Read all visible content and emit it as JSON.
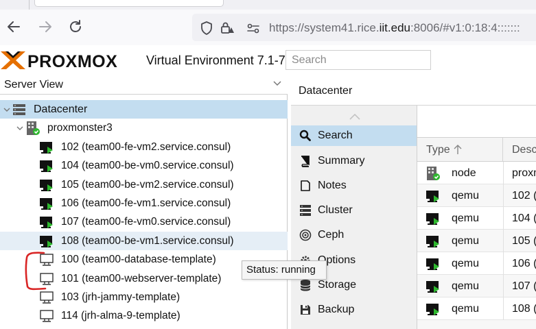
{
  "browser": {
    "url_prefix": "https://system41.rice.",
    "url_host": "iit.edu",
    "url_suffix": ":8006/#v1:0:18:4:::::::"
  },
  "header": {
    "logo_text": "PROXMOX",
    "version": "Virtual Environment 7.1-7",
    "search_placeholder": "Search"
  },
  "tree": {
    "view_label": "Server View",
    "datacenter": "Datacenter",
    "node": "proxmonster3",
    "vms": [
      {
        "label": "102 (team00-fe-vm2.service.consul)",
        "status": "running"
      },
      {
        "label": "104 (team00-be-vm0.service.consul)",
        "status": "running"
      },
      {
        "label": "105 (team00-be-vm2.service.consul)",
        "status": "running"
      },
      {
        "label": "106 (team00-fe-vm1.service.consul)",
        "status": "running"
      },
      {
        "label": "107 (team00-fe-vm0.service.consul)",
        "status": "running"
      },
      {
        "label": "108 (team00-be-vm1.service.consul)",
        "status": "running"
      }
    ],
    "templates": [
      {
        "label": "100 (team00-database-template)"
      },
      {
        "label": "101 (team00-webserver-template)"
      },
      {
        "label": "103 (jrh-jammy-template)"
      },
      {
        "label": "114 (jrh-alma-9-template)"
      }
    ]
  },
  "tooltip": "Status: running",
  "content": {
    "title": "Datacenter",
    "nav": [
      {
        "label": "Search",
        "icon": "search-icon"
      },
      {
        "label": "Summary",
        "icon": "book-icon"
      },
      {
        "label": "Notes",
        "icon": "notes-icon"
      },
      {
        "label": "Cluster",
        "icon": "server-icon"
      },
      {
        "label": "Ceph",
        "icon": "ceph-icon"
      },
      {
        "label": "Options",
        "icon": "gear-icon"
      },
      {
        "label": "Storage",
        "icon": "database-icon"
      },
      {
        "label": "Backup",
        "icon": "floppy-icon"
      }
    ],
    "grid": {
      "col_type": "Type",
      "col_desc": "Desc",
      "rows": [
        {
          "type": "node",
          "desc": "proxm"
        },
        {
          "type": "qemu",
          "desc": "102 ("
        },
        {
          "type": "qemu",
          "desc": "104 ("
        },
        {
          "type": "qemu",
          "desc": "105 ("
        },
        {
          "type": "qemu",
          "desc": "106 ("
        },
        {
          "type": "qemu",
          "desc": "107 ("
        },
        {
          "type": "qemu",
          "desc": "108 ("
        }
      ]
    }
  },
  "colors": {
    "brand_orange": "#e57000",
    "selection": "#c3ddf0",
    "running_green": "#2eb82e",
    "annotation_red": "#d92525"
  }
}
